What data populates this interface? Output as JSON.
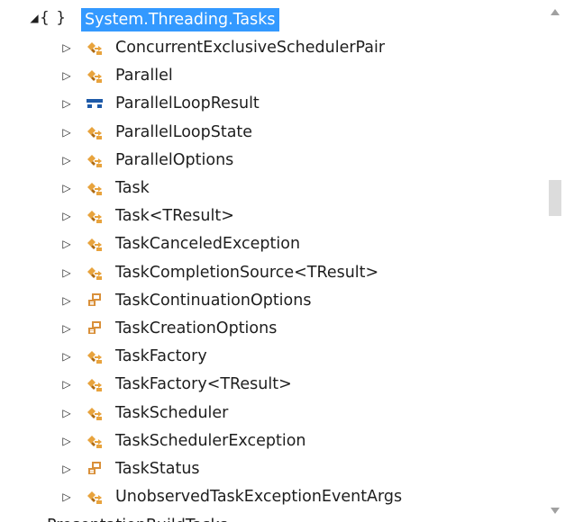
{
  "namespace": {
    "braces": "{ }",
    "label": "System.Threading.Tasks",
    "expander": "◢"
  },
  "items": [
    {
      "label": "ConcurrentExclusiveSchedulerPair",
      "icon": "class-icon"
    },
    {
      "label": "Parallel",
      "icon": "class-icon"
    },
    {
      "label": "ParallelLoopResult",
      "icon": "struct-icon"
    },
    {
      "label": "ParallelLoopState",
      "icon": "class-icon"
    },
    {
      "label": "ParallelOptions",
      "icon": "class-icon"
    },
    {
      "label": "Task",
      "icon": "class-icon"
    },
    {
      "label": "Task<TResult>",
      "icon": "class-icon"
    },
    {
      "label": "TaskCanceledException",
      "icon": "class-icon"
    },
    {
      "label": "TaskCompletionSource<TResult>",
      "icon": "class-icon"
    },
    {
      "label": "TaskContinuationOptions",
      "icon": "enum-icon"
    },
    {
      "label": "TaskCreationOptions",
      "icon": "enum-icon"
    },
    {
      "label": "TaskFactory",
      "icon": "class-icon"
    },
    {
      "label": "TaskFactory<TResult>",
      "icon": "class-icon"
    },
    {
      "label": "TaskScheduler",
      "icon": "class-icon"
    },
    {
      "label": "TaskSchedulerException",
      "icon": "class-icon"
    },
    {
      "label": "TaskStatus",
      "icon": "enum-icon"
    },
    {
      "label": "UnobservedTaskExceptionEventArgs",
      "icon": "class-icon"
    }
  ],
  "partial_next_item": {
    "label": "PresentationBuildTasks"
  },
  "colors": {
    "selection": "#3399ff",
    "class_icon": "#e8a33d",
    "struct_icon": "#1e5aa8",
    "enum_icon": "#d9903a"
  }
}
